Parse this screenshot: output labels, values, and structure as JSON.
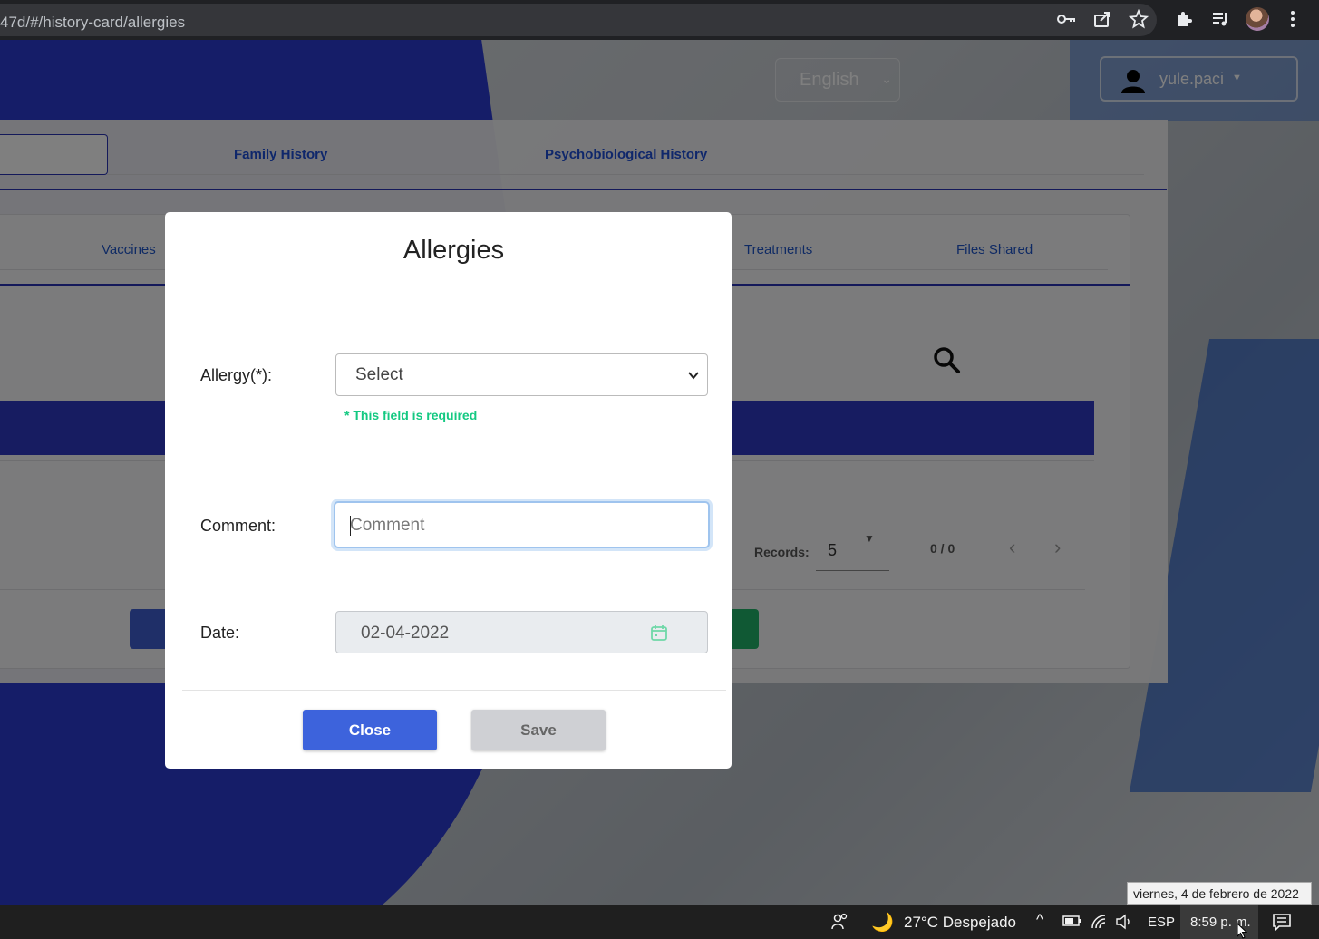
{
  "browser": {
    "url": "47d/#/history-card/allergies"
  },
  "header": {
    "language": "English",
    "username": "yule.paci"
  },
  "main_tabs": [
    {
      "label": "Family History"
    },
    {
      "label": "Psychobiological History"
    }
  ],
  "sub_tabs": [
    {
      "label": "Vaccines"
    },
    {
      "label": "Treatments"
    },
    {
      "label": "Files Shared"
    }
  ],
  "table": {
    "records_label": "Records:",
    "records_value": "5",
    "page_count": "0 / 0"
  },
  "modal": {
    "title": "Allergies",
    "allergy_label": "Allergy(*):",
    "allergy_value": "Select",
    "required_message": "* This field is required",
    "comment_label": "Comment:",
    "comment_placeholder": "Comment",
    "date_label": "Date:",
    "date_value": "02-04-2022",
    "close_label": "Close",
    "save_label": "Save"
  },
  "taskbar": {
    "weather": "27°C  Despejado",
    "language": "ESP",
    "time": "8:59 p. m.",
    "date_tooltip": "viernes, 4 de febrero de 2022"
  },
  "colors": {
    "primary": "#3d63dc",
    "table_header": "#2f39c2",
    "required": "#14c982",
    "link": "#1f4fd6"
  }
}
